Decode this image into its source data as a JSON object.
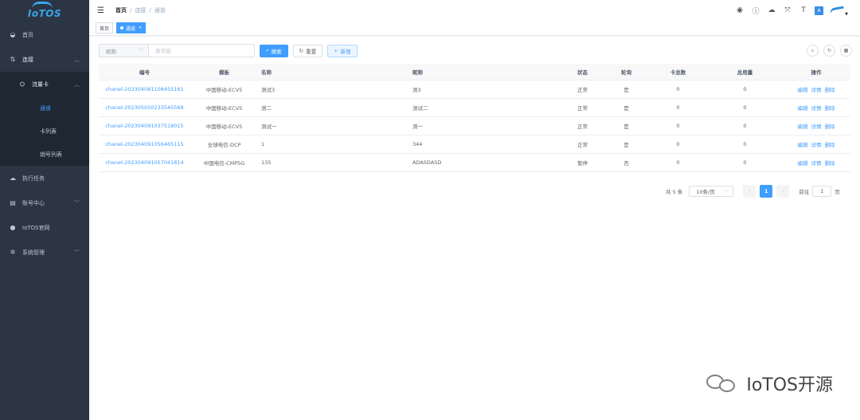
{
  "brand": {
    "logo_text": "IoTOS"
  },
  "sidebar": {
    "items": [
      {
        "label": "首页",
        "icon": "dashboard-icon"
      },
      {
        "label": "连接",
        "icon": "connection-icon",
        "open": true
      },
      {
        "label": "流量卡",
        "icon": "card-icon",
        "open": true
      },
      {
        "label": "通道",
        "active": true
      },
      {
        "label": "卡列表"
      },
      {
        "label": "销号列表"
      },
      {
        "label": "执行任务",
        "icon": "task-icon"
      },
      {
        "label": "账号中心",
        "icon": "account-icon"
      },
      {
        "label": "IoTOS官网",
        "icon": "globe-icon"
      },
      {
        "label": "系统管理",
        "icon": "settings-icon"
      }
    ]
  },
  "breadcrumb": {
    "home": "首页",
    "level2": "连接",
    "level3": "通道"
  },
  "tags": {
    "home": "首页",
    "current": "通道"
  },
  "search": {
    "field_select": "昵称",
    "placeholder": "查询值",
    "search_label": "搜索",
    "reset_label": "重置",
    "add_label": "新增"
  },
  "table": {
    "headers": [
      "编号",
      "模板",
      "名称",
      "昵称",
      "状态",
      "轮询",
      "卡总数",
      "总用量",
      "操作"
    ],
    "rows": [
      {
        "id": "chanel-20230408110845516​1",
        "template": "中国移动-ECV5",
        "name": "测试3",
        "nickname": "测3",
        "status": "正常",
        "poll": "是",
        "total_cards": "0",
        "usage": "0"
      },
      {
        "id": "chanel-20230505023354556​8",
        "template": "中国移动-ECV5",
        "name": "测二",
        "nickname": "测试二",
        "status": "正常",
        "poll": "是",
        "total_cards": "0",
        "usage": "0"
      },
      {
        "id": "chanel-20230409103751801​5",
        "template": "中国移动-ECV5",
        "name": "测试一",
        "nickname": "测一",
        "status": "正常",
        "poll": "是",
        "total_cards": "0",
        "usage": "0"
      },
      {
        "id": "chanel-20230409105646511​5",
        "template": "全球电信-DCP",
        "name": "1",
        "nickname": "344",
        "status": "正常",
        "poll": "是",
        "total_cards": "0",
        "usage": "0"
      },
      {
        "id": "chanel-20230409105704181​4",
        "template": "中国电信-CMP5G",
        "name": "135",
        "nickname": "ADASDASD",
        "status": "暂停",
        "poll": "否",
        "total_cards": "0",
        "usage": "0"
      }
    ],
    "ops": {
      "edit": "编辑",
      "detail": "详情",
      "delete": "删除"
    }
  },
  "pagination": {
    "total": "共 5 条",
    "page_size": "10条/页",
    "current": "1",
    "goto_label": "前往",
    "goto_value": "1",
    "page_unit": "页"
  },
  "watermark": {
    "text": "IoTOS开源"
  }
}
